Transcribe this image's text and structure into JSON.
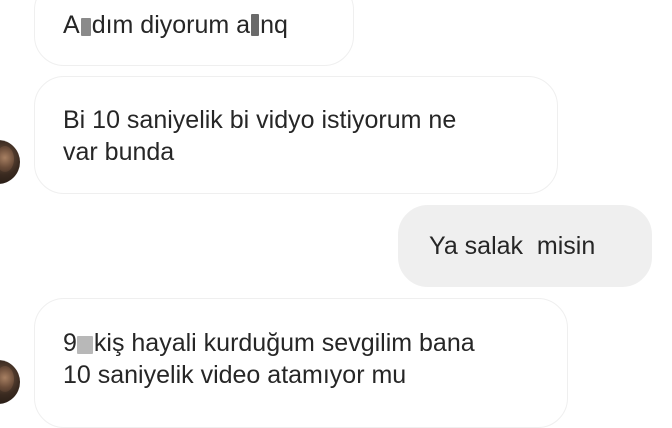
{
  "messages": [
    {
      "direction": "incoming",
      "lines": [
        "A",
        "dım diyorum a",
        "nq"
      ]
    },
    {
      "direction": "incoming",
      "lines": [
        "Bi 10 saniyelik bi vidyo istiyorum ne",
        "var bunda"
      ]
    },
    {
      "direction": "outgoing",
      "lines": [
        "Ya salak  misin"
      ]
    },
    {
      "direction": "incoming",
      "lines": [
        "9",
        "kiş hayali kurduğum sevgilim bana",
        "10 saniyelik video atamıyor mu"
      ]
    }
  ],
  "colors": {
    "incoming_bubble_bg": "#ffffff",
    "incoming_bubble_border": "#efefef",
    "outgoing_bubble_bg": "#efefef",
    "text": "#262626"
  },
  "icons": {
    "avatar": "user-avatar-photo"
  }
}
